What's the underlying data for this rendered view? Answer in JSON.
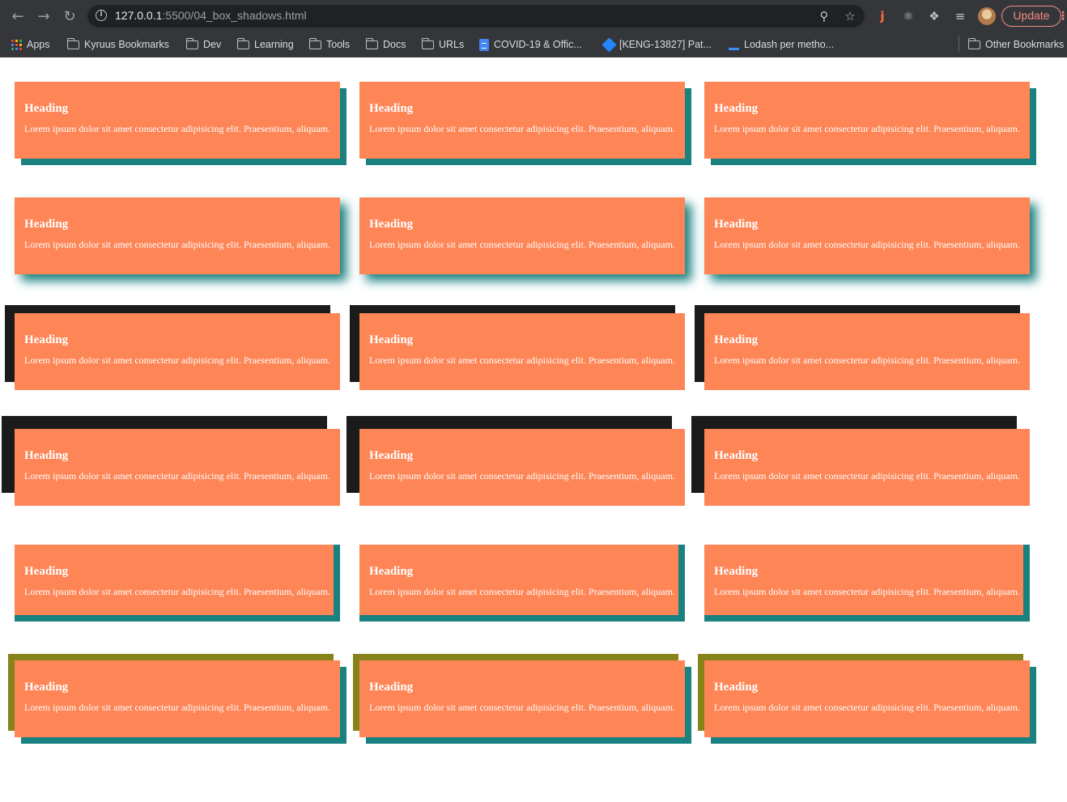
{
  "browser": {
    "url_host": "127.0.0.1",
    "url_rest": ":5500/04_box_shadows.html",
    "update_label": "Update",
    "bookmarks": [
      "Apps",
      "Kyruus Bookmarks",
      "Dev",
      "Learning",
      "Tools",
      "Docs",
      "URLs",
      "COVID-19 & Offic...",
      "[KENG-13827] Pat...",
      "Lodash per metho...",
      "Other Bookmarks"
    ]
  },
  "card": {
    "heading": "Heading",
    "text": "Lorem ipsum dolor sit amet consectetur adipisicing elit. Praesentium, aliquam."
  },
  "colors": {
    "card_bg": "#fd8556",
    "teal_shadow": "#198180",
    "dark_shadow": "#1b1b1c",
    "olive_shadow": "#858319",
    "chrome_bg": "#35363a"
  }
}
